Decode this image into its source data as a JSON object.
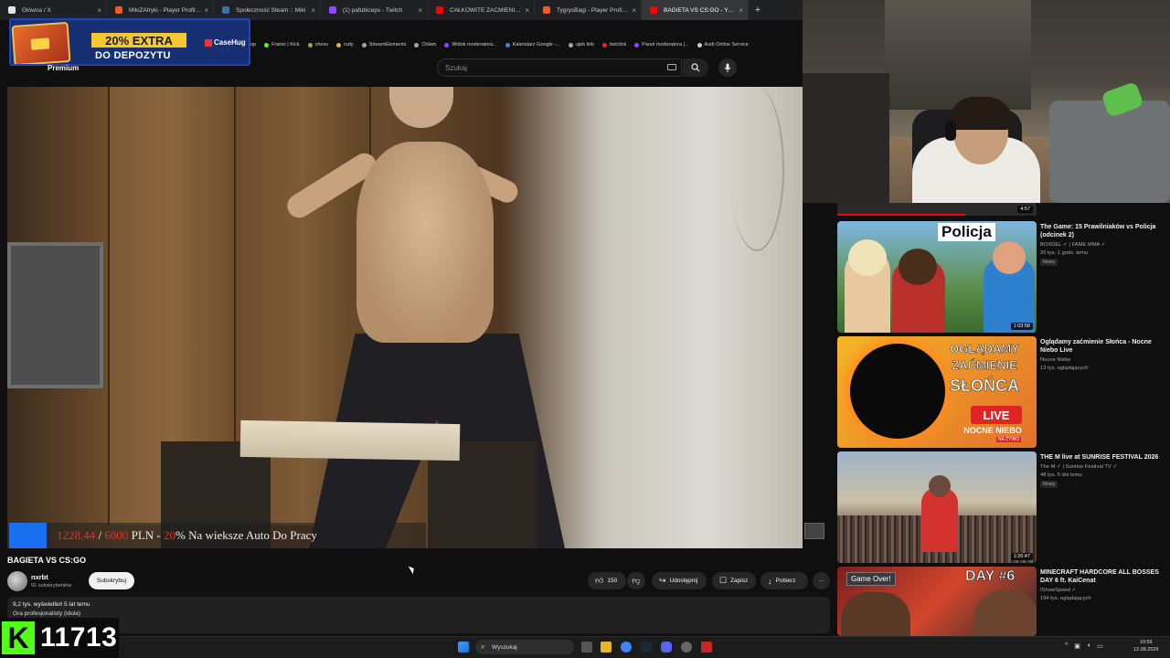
{
  "browser": {
    "tabs": [
      {
        "label": "Główna / X",
        "color": "#e7e7e7"
      },
      {
        "label": "MikiZAfryki - Player Profile - FACEIT",
        "color": "#f25a24"
      },
      {
        "label": "Społeczność Steam :: Miki",
        "color": "#3b6ea5"
      },
      {
        "label": "(1) pafubiceps - Twitch",
        "color": "#9146ff"
      },
      {
        "label": "CAŁKOWITE ZAĆMIENIE SŁOŃCA",
        "color": "#ff0000"
      },
      {
        "label": "TygrysBagi - Player Profile - FACEIT",
        "color": "#f25a24"
      },
      {
        "label": "BAGIETA VS CS:GO - YouTube",
        "color": "#ff0000",
        "active": true
      }
    ],
    "new_tab": "+",
    "bookmarks": [
      "op",
      "Franio | Kick",
      "chess",
      "rudy",
      "StreamElements",
      "Chłam",
      "Widok moderatora...",
      "Kalendarz Google -...",
      "ujeb link",
      "betclick",
      "Panel moderatora |...",
      "Audi Online Service"
    ]
  },
  "promo": {
    "extra": "20% EXTRA",
    "sub": "DO DEPOZYTU",
    "brand": "CaseHug"
  },
  "youtube": {
    "logo_sub": "Premium",
    "search_placeholder": "Szukaj",
    "video": {
      "title": "BAGIETA VS CS:GO",
      "channel": "nxrbt",
      "subscribers": "91 subskrybentów",
      "subscribe_label": "Subskrybuj",
      "likes": "150",
      "share_label": "Udostępnij",
      "save_label": "Zapisz",
      "download_label": "Pobierz",
      "more": "···",
      "views_date": "9,2 tys. wyświetleń  5 lat temu",
      "description": "Gra profesjonalisty (idola)"
    },
    "goal": {
      "amount": "1228.44",
      "sep": " / ",
      "target": "6000",
      "currency": " PLN - ",
      "pct": "20",
      "text": "% Na wieksze Auto Do Pracy",
      "fill_fraction": 0.2
    },
    "top_duration": "4:57",
    "recommendations": [
      {
        "title": "The Game: 15 Prawilniaków vs Policja (odcinek 2)",
        "channel": "BOXDEL ✓ | FAME MMA ✓",
        "meta": "20 tys.  1 godz. temu",
        "badge": "Nowy",
        "duration": "1:03:58",
        "thumb_text": "Policja"
      },
      {
        "title": "Oglądamy zaćmienie Słońca - Nocne Niebo Live",
        "channel": "Nocne Niebo",
        "meta": "13 tys. oglądających",
        "badge": "",
        "duration": "",
        "thumb_l1": "OGLĄDAMY",
        "thumb_l2": "ZAĆMIENIE",
        "thumb_l3": "SŁOŃCA",
        "thumb_live": "LIVE",
        "thumb_nocne": "NOCNE NIEBO",
        "thumb_nazywo": "NA ŻYWO"
      },
      {
        "title": "THE M live at SUNRISE FESTIVAL 2026",
        "channel": "The M ✓ | Sunrise Festival TV ✓",
        "meta": "48 tys.  5 dni temu",
        "badge": "Nowy",
        "duration": "1:26:47"
      },
      {
        "title": "MINECRAFT HARDCORE ALL BOSSES DAY 6 ft. KaiCenat",
        "channel": "IShowSpeed ✓",
        "meta": "194 tys. oglądających",
        "badge": "",
        "duration": "",
        "thumb_game": "Game Over!",
        "thumb_day": "DAY #6"
      }
    ]
  },
  "taskbar": {
    "search": "Wyszukaj",
    "time": "19:56",
    "date": "12.08.2026"
  },
  "kick": {
    "logo": "K",
    "count": "11713"
  }
}
